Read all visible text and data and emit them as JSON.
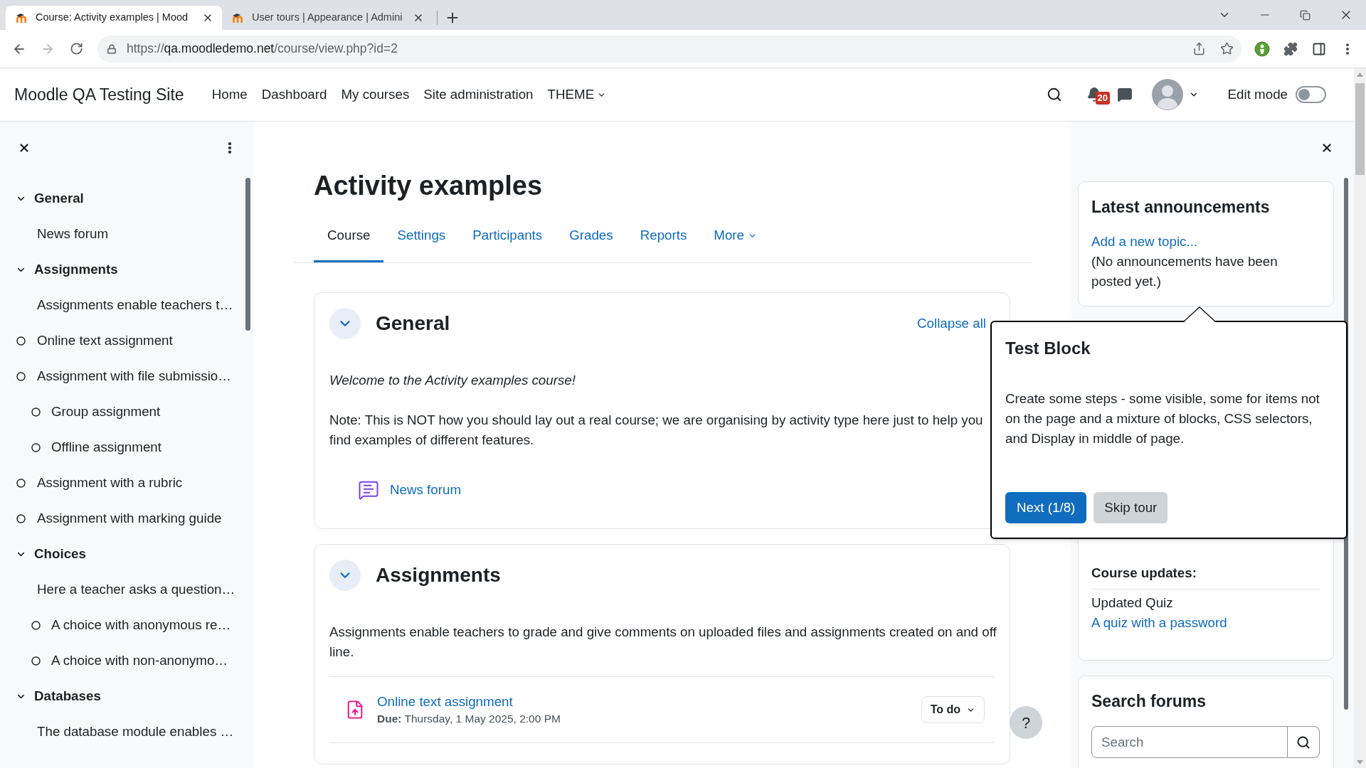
{
  "browser": {
    "tabs": [
      {
        "title": "Course: Activity examples | Mood",
        "selected": true
      },
      {
        "title": "User tours | Appearance | Admini",
        "selected": false
      }
    ],
    "url": {
      "scheme": "https://",
      "host": "qa.moodledemo.net",
      "path": "/course/view.php?id=2"
    }
  },
  "navbar": {
    "site_name": "Moodle QA Testing Site",
    "links": [
      {
        "label": "Home",
        "dropdown": false
      },
      {
        "label": "Dashboard",
        "dropdown": false
      },
      {
        "label": "My courses",
        "dropdown": false
      },
      {
        "label": "Site administration",
        "dropdown": false
      },
      {
        "label": "THEME",
        "dropdown": true
      }
    ],
    "notification_count": "20",
    "edit_mode": {
      "label": "Edit mode",
      "on": false
    }
  },
  "course_index": {
    "sections": [
      {
        "title": "General",
        "expanded": true,
        "children": [
          {
            "kind": "activity",
            "title": "News forum",
            "completion": false
          }
        ]
      },
      {
        "title": "Assignments",
        "expanded": true,
        "children": [
          {
            "kind": "label",
            "title": "Assignments enable teachers t…"
          },
          {
            "kind": "activity",
            "title": "Online text assignment",
            "completion": true
          },
          {
            "kind": "activity",
            "title": "Assignment with file submissio…",
            "completion": true,
            "children": [
              {
                "kind": "activity",
                "title": "Group assignment",
                "completion": true
              },
              {
                "kind": "activity",
                "title": "Offline assignment",
                "completion": true
              }
            ]
          },
          {
            "kind": "activity",
            "title": "Assignment with a rubric",
            "completion": true
          },
          {
            "kind": "activity",
            "title": "Assignment with marking guide",
            "completion": true
          }
        ]
      },
      {
        "title": "Choices",
        "expanded": true,
        "children": [
          {
            "kind": "label",
            "title": "Here a teacher asks a question…",
            "children": [
              {
                "kind": "activity",
                "title": "A choice with anonymous re…",
                "completion": true
              },
              {
                "kind": "activity",
                "title": "A choice with non-anonymo…",
                "completion": true
              }
            ]
          }
        ]
      },
      {
        "title": "Databases",
        "expanded": true,
        "children": [
          {
            "kind": "label",
            "title": "The database module enables …"
          }
        ]
      }
    ]
  },
  "course": {
    "title": "Activity examples",
    "tabs": [
      {
        "label": "Course",
        "selected": true,
        "dropdown": false
      },
      {
        "label": "Settings",
        "selected": false,
        "dropdown": false
      },
      {
        "label": "Participants",
        "selected": false,
        "dropdown": false
      },
      {
        "label": "Grades",
        "selected": false,
        "dropdown": false
      },
      {
        "label": "Reports",
        "selected": false,
        "dropdown": false
      },
      {
        "label": "More",
        "selected": false,
        "dropdown": true
      }
    ],
    "sections": [
      {
        "title": "General",
        "expanded": true,
        "action": "Collapse all",
        "summary": [
          {
            "text": "Welcome to the Activity examples course!",
            "italic": true
          },
          {
            "text": "Note: This is NOT how you should lay out a real course; we are organising by activity type here just to help you find examples of different features.",
            "italic": false
          }
        ],
        "activities": [
          {
            "kind": "forum",
            "name": "News forum"
          }
        ]
      },
      {
        "title": "Assignments",
        "expanded": true,
        "summary": [
          {
            "text": "Assignments enable teachers to grade and give comments on uploaded files and assignments created on and off line.",
            "italic": false
          }
        ],
        "activities": [
          {
            "kind": "assignment",
            "name": "Online text assignment",
            "due": "**Due:** Thursday, 1 May 2025, 2:00 PM",
            "completion": "To do"
          }
        ]
      }
    ]
  },
  "right_drawer": {
    "blocks": [
      {
        "kind": "announcements",
        "title": "Latest announcements",
        "link": "Add a new topic...",
        "text": "(No announcements have been posted yet.)"
      },
      {
        "kind": "recent_activity",
        "heading": "Course updates:",
        "items": [
          {
            "kind": "text",
            "text": "Updated Quiz"
          },
          {
            "kind": "link",
            "text": "A quiz with a password"
          }
        ]
      },
      {
        "kind": "search",
        "title": "Search forums",
        "placeholder": "Search"
      }
    ]
  },
  "tour": {
    "title": "Test Block",
    "body": "Create some steps - some visible, some for items not on the page and a mixture of blocks, CSS selectors, and Display in middle of page.",
    "buttons": [
      {
        "label": "Next (1/8)",
        "kind": "primary"
      },
      {
        "label": "Skip tour",
        "kind": "secondary"
      }
    ]
  },
  "help_button": {
    "label": "?"
  }
}
